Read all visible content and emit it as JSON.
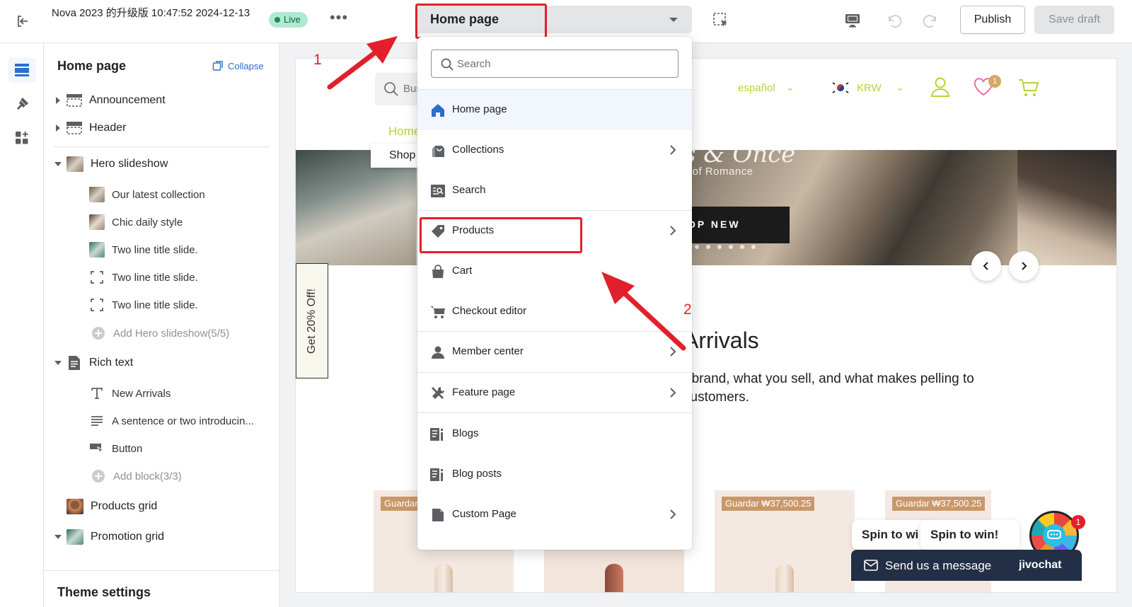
{
  "topbar": {
    "theme_name": "Nova 2023 的升级版 10:47:52 2024-12-13",
    "live_label": "Live",
    "more_label": "•••",
    "page_select": "Home page",
    "publish_label": "Publish",
    "save_label": "Save draft"
  },
  "sidebar": {
    "title": "Home page",
    "collapse_label": "Collapse",
    "sections": {
      "announcement": "Announcement",
      "header": "Header",
      "hero": "Hero slideshow",
      "hero_blocks": [
        "Our latest collection",
        "Chic daily style",
        "Two line title slide.",
        "Two line title slide.",
        "Two line title slide."
      ],
      "hero_add": "Add Hero slideshow(5/5)",
      "rich_text": "Rich text",
      "rich_blocks": [
        "New Arrivals",
        "A sentence or two introducin...",
        "Button"
      ],
      "rich_add": "Add block(3/3)",
      "products_grid": "Products grid",
      "promotion_grid": "Promotion grid"
    },
    "theme_settings": "Theme settings"
  },
  "menu": {
    "search_placeholder": "Search",
    "items": [
      {
        "label": "Home page",
        "icon": "home-icon",
        "chevron": false
      },
      {
        "label": "Collections",
        "icon": "collections-icon",
        "chevron": true
      },
      {
        "label": "Search",
        "icon": "search-page-icon",
        "chevron": false
      },
      {
        "label": "Products",
        "icon": "tag-icon",
        "chevron": true
      },
      {
        "label": "Cart",
        "icon": "cart-bag-icon",
        "chevron": false
      },
      {
        "label": "Checkout editor",
        "icon": "checkout-cart-icon",
        "chevron": false
      },
      {
        "label": "Member center",
        "icon": "person-icon",
        "chevron": true
      },
      {
        "label": "Feature page",
        "icon": "tools-icon",
        "chevron": true
      },
      {
        "label": "Blogs",
        "icon": "blog-icon",
        "chevron": false
      },
      {
        "label": "Blog posts",
        "icon": "blog-post-icon",
        "chevron": false
      },
      {
        "label": "Custom Page",
        "icon": "page-icon",
        "chevron": true
      }
    ]
  },
  "preview": {
    "search_text": "Bus",
    "language": "español",
    "currency": "KRW",
    "wishlist_count": "1",
    "nav_home": "Home",
    "nav_shop": "Shop",
    "hero_title": "s & Once",
    "hero_subtitle": "s of Romance",
    "hero_cta": "OP NEW",
    "side_promo": "Get 20% Off!",
    "section_title": "Arrivals",
    "section_body": "r brand, what you sell, and what makes pelling to customers.",
    "price_tags": [
      "Guardar",
      "Guardar ₩37,500.25",
      "Guardar ₩37,500.25"
    ],
    "spin_left": "Spin to wi",
    "spin_right": "Spin to win!",
    "spin_badge": "1",
    "chat_message": "Send us a message",
    "chat_brand": "jivochat"
  },
  "annotations": {
    "step1": "1",
    "step2": "2"
  },
  "colors": {
    "accent": "#2c6ecb",
    "annotation": "#e2202b",
    "store_accent": "#b5d334"
  }
}
